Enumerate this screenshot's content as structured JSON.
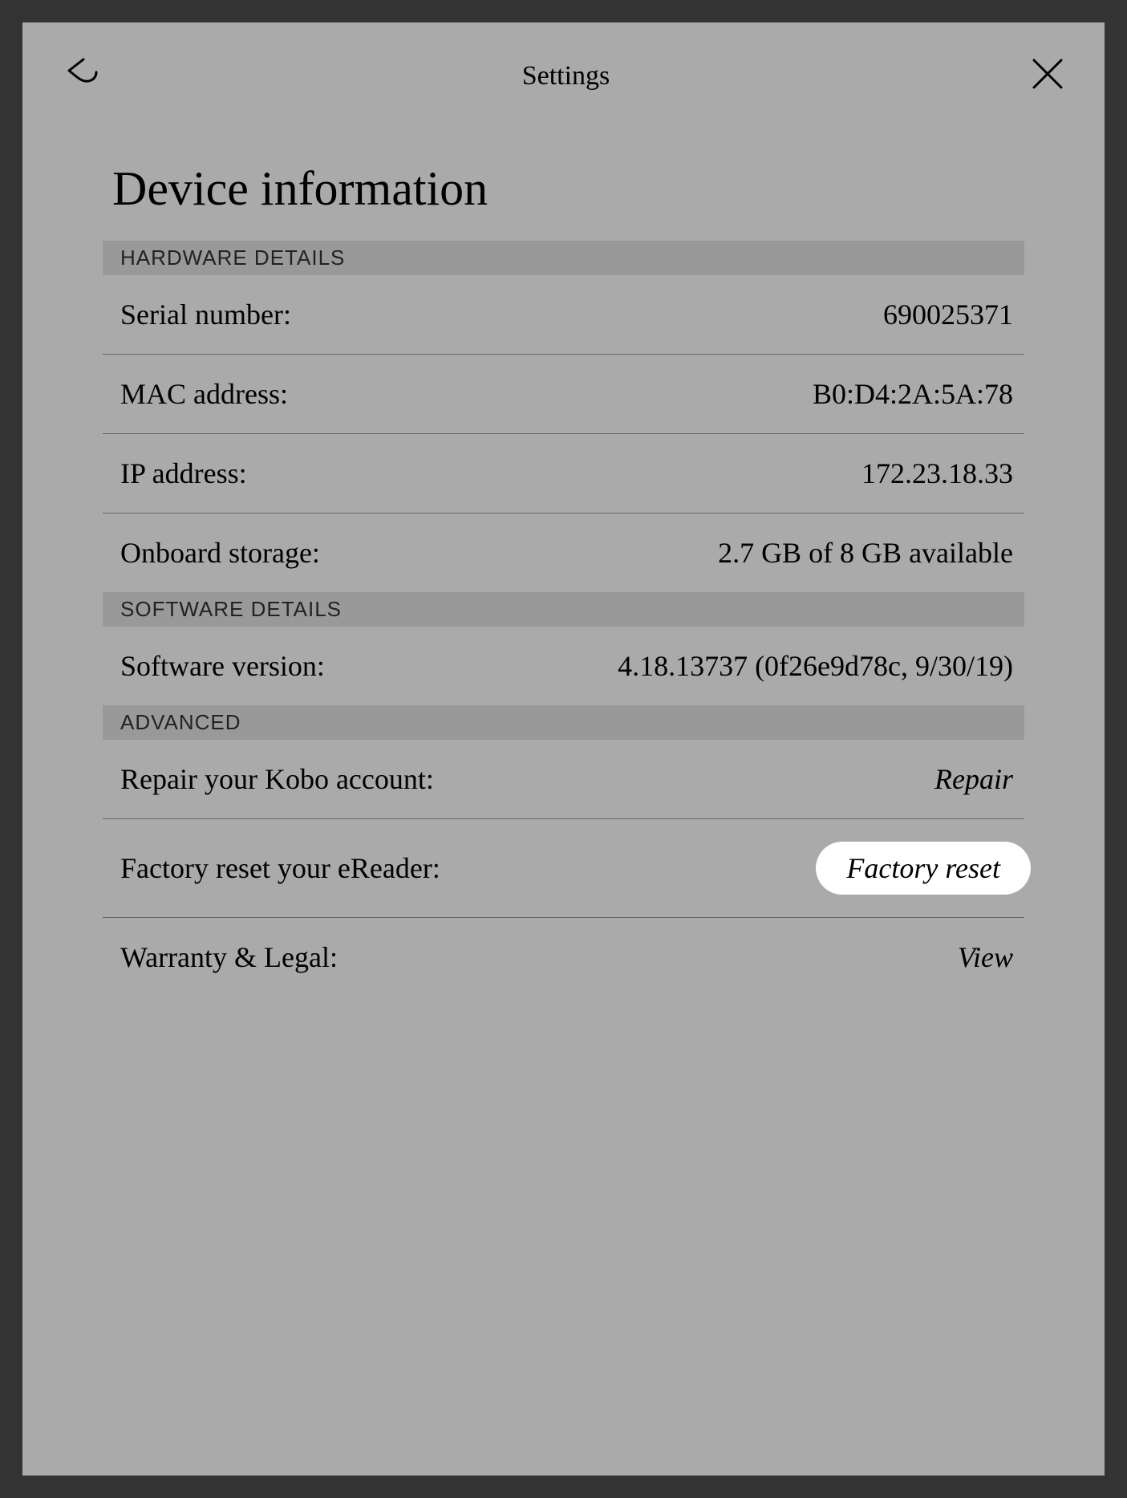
{
  "header": {
    "title": "Settings"
  },
  "page": {
    "heading": "Device information"
  },
  "sections": {
    "hardware": {
      "title": "HARDWARE DETAILS",
      "serial": {
        "label": "Serial number:",
        "value": "690025371"
      },
      "mac": {
        "label": "MAC address:",
        "value": "B0:D4:2A:5A:78"
      },
      "ip": {
        "label": "IP address:",
        "value": "172.23.18.33"
      },
      "storage": {
        "label": "Onboard storage:",
        "value": "2.7 GB of 8 GB available"
      }
    },
    "software": {
      "title": "SOFTWARE DETAILS",
      "version": {
        "label": "Software version:",
        "value": "4.18.13737 (0f26e9d78c, 9/30/19)"
      }
    },
    "advanced": {
      "title": "ADVANCED",
      "repair": {
        "label": "Repair your Kobo account:",
        "action": "Repair"
      },
      "factory": {
        "label": "Factory reset your eReader:",
        "action": "Factory reset"
      },
      "warranty": {
        "label": "Warranty & Legal:",
        "action": "View"
      }
    }
  }
}
